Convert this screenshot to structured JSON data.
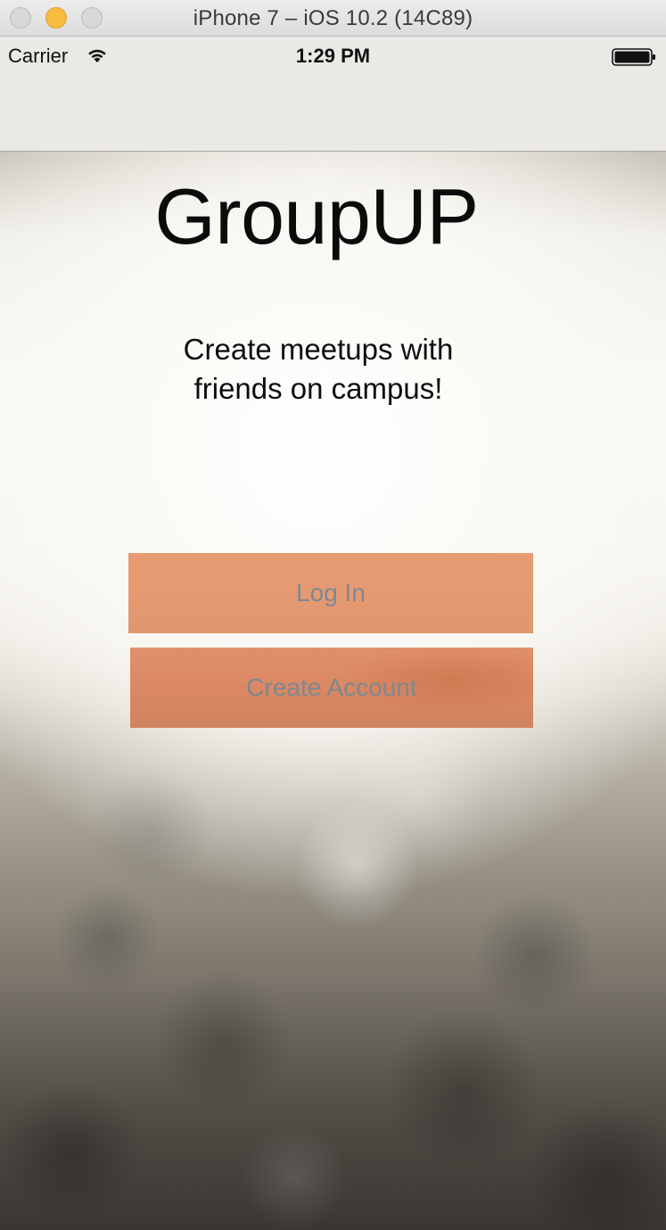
{
  "window": {
    "title": "iPhone 7 – iOS 10.2 (14C89)"
  },
  "status_bar": {
    "carrier": "Carrier",
    "time": "1:29 PM",
    "icons": [
      "wifi-icon",
      "battery-icon"
    ]
  },
  "app": {
    "title": "GroupUP",
    "tagline_line1": "Create meetups with",
    "tagline_line2": "friends on campus!",
    "login_label": "Log In",
    "create_account_label": "Create Account"
  },
  "colors": {
    "button_fill": "#e79b72",
    "button_text": "#7e8890",
    "traffic_minimize": "#f6bd3f"
  }
}
